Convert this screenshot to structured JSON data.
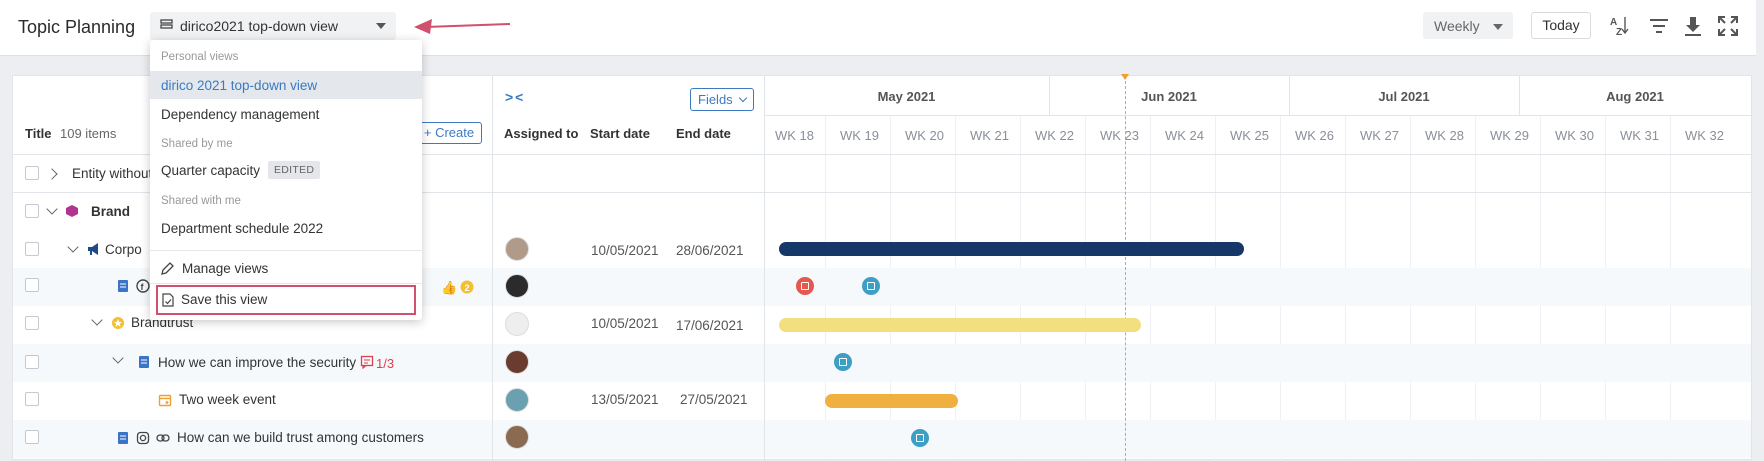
{
  "header": {
    "title": "Topic Planning",
    "view_selected": "dirico2021 top-down view",
    "timescale": "Weekly",
    "today_label": "Today"
  },
  "view_menu": {
    "section_personal": "Personal views",
    "personal_views": [
      "dirico 2021 top-down view",
      "Dependency management"
    ],
    "section_shared_by_me": "Shared by me",
    "shared_by_me": {
      "label": "Quarter capacity",
      "badge": "EDITED"
    },
    "section_shared_with_me": "Shared with me",
    "shared_with_me": [
      "Department schedule 2022"
    ],
    "manage_label": "Manage views",
    "save_label": "Save this view"
  },
  "table": {
    "title_label": "Title",
    "item_count": "109 items",
    "create_label": "+ Create",
    "fields_label": "Fields",
    "collapse_label": "> <",
    "columns": {
      "assigned": "Assigned to",
      "start": "Start date",
      "end": "End date"
    },
    "rows": [
      {
        "title": "Entity without"
      },
      {
        "title": "Brand"
      },
      {
        "title": "Corpo",
        "start": "10/05/2021",
        "end": "28/06/2021"
      },
      {
        "title": ""
      },
      {
        "title": "Brandtrust",
        "start": "10/05/2021",
        "end": "17/06/2021"
      },
      {
        "title": "How we can improve the security",
        "count": "1/3"
      },
      {
        "title": "Two week event",
        "start": "13/05/2021",
        "end": "27/05/2021"
      },
      {
        "title": "How can we build trust among customers"
      }
    ]
  },
  "timeline": {
    "months": [
      "May 2021",
      "Jun 2021",
      "Jul 2021",
      "Aug 2021"
    ],
    "weeks": [
      "WK 18",
      "WK 19",
      "WK 20",
      "WK 21",
      "WK 22",
      "WK 23",
      "WK 24",
      "WK 25",
      "WK 26",
      "WK 27",
      "WK 28",
      "WK 29",
      "WK 30",
      "WK 31",
      "WK 32"
    ]
  },
  "colors": {
    "bar_navy": "#163869",
    "bar_yellow": "#f2df80",
    "bar_orange": "#f0b040",
    "milestone_red": "#e5584f",
    "milestone_teal": "#3d9fc4",
    "highlight": "#d0506e",
    "link": "#3b7ac2"
  }
}
